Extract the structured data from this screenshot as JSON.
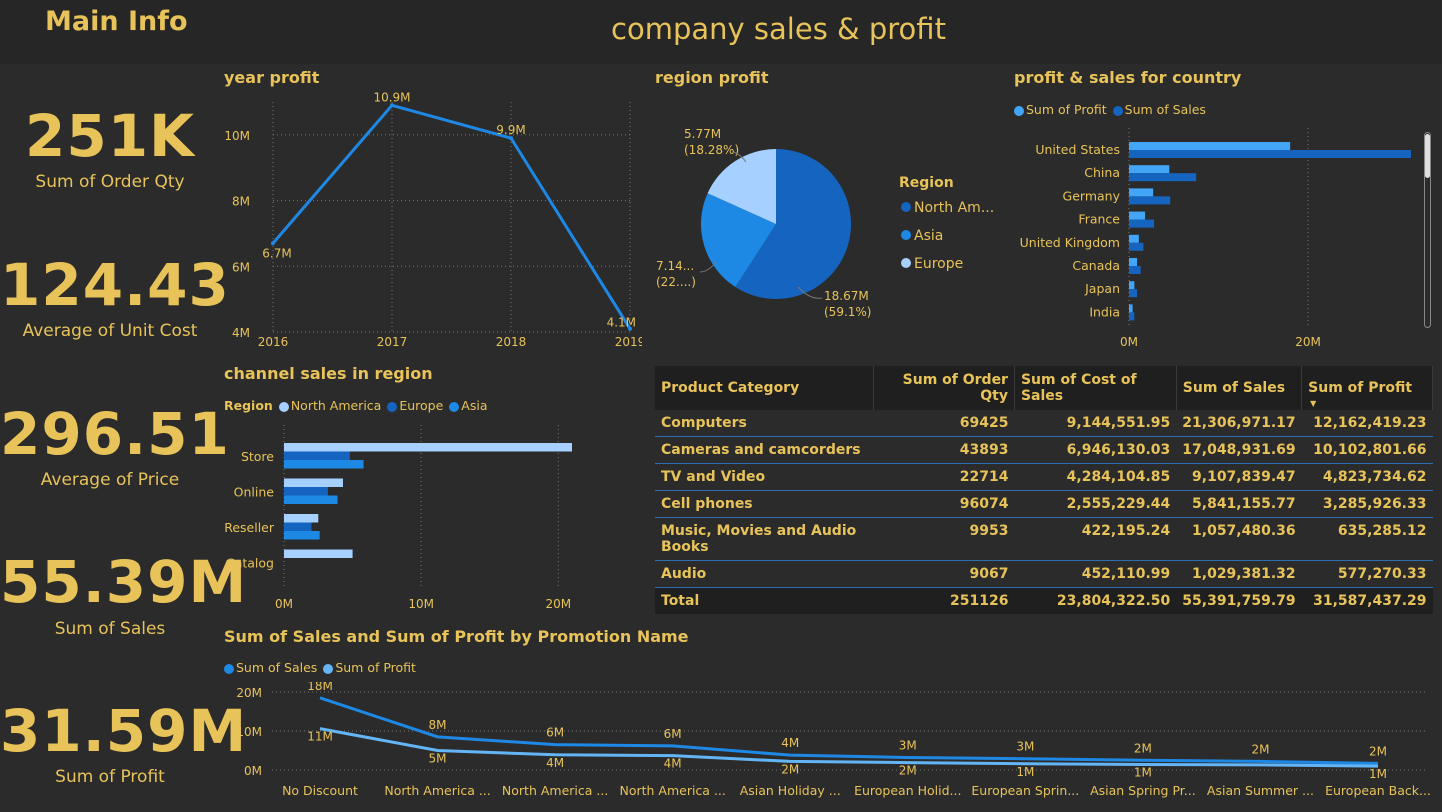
{
  "header": {
    "main_info": "Main Info",
    "title": "company sales & profit"
  },
  "kpis": [
    {
      "value": "251K",
      "label": "Sum of Order Qty"
    },
    {
      "value": "124.43",
      "label": "Average of Unit Cost"
    },
    {
      "value": "296.51",
      "label": "Average of Price"
    },
    {
      "value": "55.39M",
      "label": "Sum of Sales"
    },
    {
      "value": "31.59M",
      "label": "Sum of Profit"
    }
  ],
  "colors": {
    "gold": "#e8c35a",
    "north_america": "#a6d0ff",
    "europe": "#1565c0",
    "asia": "#1e88e5",
    "profit_light": "#42a5f5",
    "sales_dark": "#1565c0"
  },
  "chart_data": [
    {
      "id": "year-profit",
      "type": "line",
      "title": "year profit",
      "x": [
        "2016",
        "2017",
        "2018",
        "2019"
      ],
      "values": [
        6.7,
        10.9,
        9.9,
        4.1
      ],
      "data_labels": [
        "6.7M",
        "10.9M",
        "9.9M",
        "4.1M"
      ],
      "y_ticks": [
        "4M",
        "6M",
        "8M",
        "10M"
      ],
      "ylim": [
        4,
        11
      ],
      "grid": true
    },
    {
      "id": "region-profit",
      "type": "pie",
      "title": "region profit",
      "legend_title": "Region",
      "legend": [
        "North Am...",
        "Asia",
        "Europe"
      ],
      "values": [
        18.67,
        7.14,
        5.77
      ],
      "labels": [
        "18.67M\n(59.1%)",
        "7.14...\n(22....)",
        "5.77M\n(18.28%)"
      ]
    },
    {
      "id": "country",
      "type": "bar",
      "orientation": "horizontal",
      "title": "profit & sales for country",
      "categories": [
        "United States",
        "China",
        "Germany",
        "France",
        "United Kingdom",
        "Canada",
        "Japan",
        "India"
      ],
      "series": [
        {
          "name": "Sum of Profit",
          "values": [
            18,
            4.5,
            2.7,
            1.8,
            1.1,
            0.9,
            0.6,
            0.4
          ]
        },
        {
          "name": "Sum of Sales",
          "values": [
            31.5,
            7.5,
            4.6,
            2.8,
            1.6,
            1.3,
            0.9,
            0.6
          ]
        }
      ],
      "x_ticks": [
        "0M",
        "20M"
      ],
      "xlim": [
        0,
        31.5
      ]
    },
    {
      "id": "channel",
      "type": "bar",
      "orientation": "horizontal",
      "title": "channel sales in region",
      "legend_title": "Region",
      "categories": [
        "Store",
        "Online",
        "Reseller",
        "Catalog"
      ],
      "series": [
        {
          "name": "North America",
          "values": [
            21,
            4.3,
            2.5,
            5
          ]
        },
        {
          "name": "Europe",
          "values": [
            4.8,
            3.2,
            2.0,
            0
          ]
        },
        {
          "name": "Asia",
          "values": [
            5.8,
            3.9,
            2.6,
            0
          ]
        }
      ],
      "x_ticks": [
        "0M",
        "10M",
        "20M"
      ],
      "xlim": [
        0,
        21
      ]
    },
    {
      "id": "promotion",
      "type": "line",
      "title": "Sum of Sales and Sum of Profit by Promotion Name",
      "categories": [
        "No Discount",
        "North America ...",
        "North America ...",
        "North America ...",
        "Asian Holiday ...",
        "European Holid...",
        "European Sprin...",
        "Asian Spring Pr...",
        "Asian Summer ...",
        "European Back..."
      ],
      "series": [
        {
          "name": "Sum of Sales",
          "values": [
            18.5,
            8.5,
            6.5,
            6.2,
            3.8,
            3.2,
            2.9,
            2.5,
            2.2,
            1.7
          ],
          "labels": [
            "18M",
            "8M",
            "6M",
            "6M",
            "4M",
            "3M",
            "3M",
            "2M",
            "2M",
            "2M"
          ]
        },
        {
          "name": "Sum of Profit",
          "values": [
            10.6,
            5,
            3.9,
            3.7,
            2.2,
            1.9,
            1.6,
            1.4,
            1.3,
            1.0
          ],
          "labels": [
            "11M",
            "5M",
            "4M",
            "4M",
            "2M",
            "2M",
            "1M",
            "1M",
            "",
            "1M"
          ]
        }
      ],
      "y_ticks": [
        "0M",
        "10M",
        "20M"
      ],
      "ylim": [
        0,
        20
      ]
    }
  ],
  "table": {
    "headers": [
      "Product Category",
      "Sum of Order Qty",
      "Sum of Cost of Sales",
      "Sum of Sales",
      "Sum of Profit"
    ],
    "rows": [
      [
        "Computers",
        "69425",
        "9,144,551.95",
        "21,306,971.17",
        "12,162,419.23"
      ],
      [
        "Cameras and camcorders",
        "43893",
        "6,946,130.03",
        "17,048,931.69",
        "10,102,801.66"
      ],
      [
        "TV and Video",
        "22714",
        "4,284,104.85",
        "9,107,839.47",
        "4,823,734.62"
      ],
      [
        "Cell phones",
        "96074",
        "2,555,229.44",
        "5,841,155.77",
        "3,285,926.33"
      ],
      [
        "Music, Movies and Audio Books",
        "9953",
        "422,195.24",
        "1,057,480.36",
        "635,285.12"
      ],
      [
        "Audio",
        "9067",
        "452,110.99",
        "1,029,381.32",
        "577,270.33"
      ]
    ],
    "total": [
      "Total",
      "251126",
      "23,804,322.50",
      "55,391,759.79",
      "31,587,437.29"
    ]
  }
}
